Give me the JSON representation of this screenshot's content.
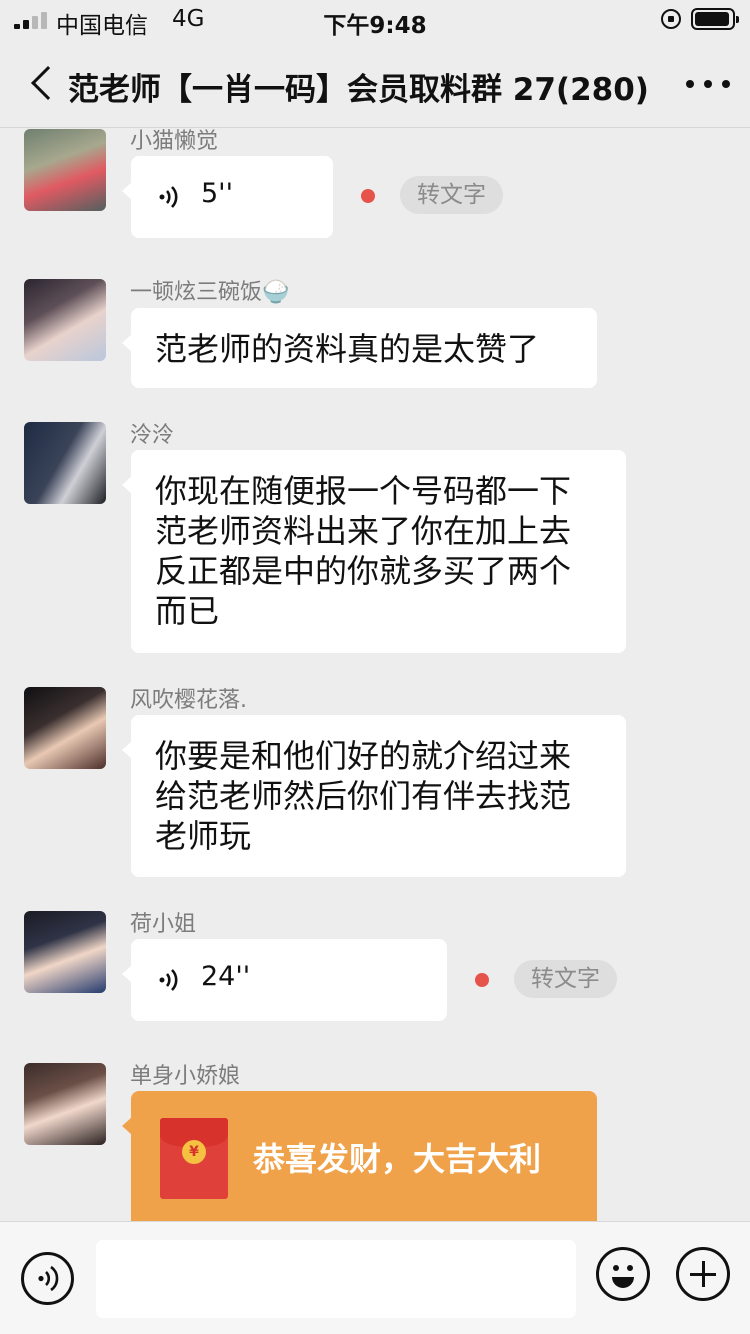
{
  "status_bar": {
    "carrier": "中国电信",
    "network": "4G",
    "time": "下午9:48",
    "icons": [
      "signal-icon",
      "rotation-lock-icon",
      "battery-icon"
    ]
  },
  "header": {
    "title": "范老师【一肖一码】会员取料群 27(280)",
    "back_icon": "chevron-left-icon",
    "more_icon": "more-icon"
  },
  "messages": [
    {
      "sender": "小猫懒觉",
      "type": "voice",
      "duration": "5''",
      "unread": true,
      "to_text_label": "转文字"
    },
    {
      "sender": "一顿炫三碗饭🍚",
      "type": "text",
      "text": "范老师的资料真的是太赞了"
    },
    {
      "sender": "泠泠",
      "type": "text",
      "lines": [
        "你现在随便报一个号码都一下",
        "范老师资料出来了你在加上去",
        "反正都是中的你就多买了两个",
        "而已"
      ]
    },
    {
      "sender": "风吹樱花落.",
      "type": "text",
      "lines": [
        "你要是和他们好的就介绍过来",
        "给范老师然后你们有伴去找范",
        "老师玩"
      ]
    },
    {
      "sender": "荷小姐",
      "type": "voice",
      "duration": "24''",
      "unread": true,
      "to_text_label": "转文字"
    },
    {
      "sender": "单身小娇娘",
      "type": "red_packet",
      "greeting": "恭喜发财，大吉大利",
      "coin_symbol": "¥"
    }
  ],
  "toolbar": {
    "voice_icon": "voice-mode-icon",
    "emoji_icon": "emoji-icon",
    "plus_icon": "plus-icon",
    "input_value": "",
    "input_placeholder": ""
  },
  "colors": {
    "background": "#ededed",
    "bubble": "#ffffff",
    "red_packet": "#f0a24b",
    "unread_dot": "#e5534b"
  }
}
